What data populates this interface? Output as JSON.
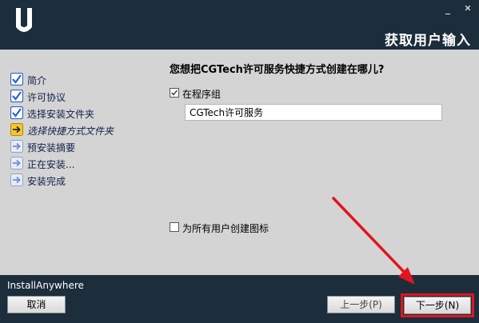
{
  "header": {
    "title": "获取用户输入",
    "minimize_glyph": "_",
    "close_glyph": "✕"
  },
  "sidebar": {
    "steps": [
      {
        "label": "简介",
        "state": "done"
      },
      {
        "label": "许可协议",
        "state": "done"
      },
      {
        "label": "选择安装文件夹",
        "state": "done"
      },
      {
        "label": "选择快捷方式文件夹",
        "state": "current"
      },
      {
        "label": "预安装摘要",
        "state": "pending"
      },
      {
        "label": "正在安装...",
        "state": "pending"
      },
      {
        "label": "安装完成",
        "state": "pending"
      }
    ]
  },
  "main": {
    "question": "您想把CGTech许可服务快捷方式创建在哪儿?",
    "program_group": {
      "label": "在程序组",
      "checked": true,
      "value": "CGTech许可服务"
    },
    "all_users": {
      "label": "为所有用户创建图标",
      "checked": false
    }
  },
  "footer": {
    "brand": "InstallAnywhere",
    "cancel_label": "取消",
    "prev_label": "上一步(P)",
    "next_label": "下一步(N)"
  },
  "colors": {
    "header_bg": "#1c2d3b",
    "body_bg": "#d4d4d4",
    "highlight": "#e2141f",
    "step_done": "#2a63c9",
    "step_current": "#f0b400"
  }
}
